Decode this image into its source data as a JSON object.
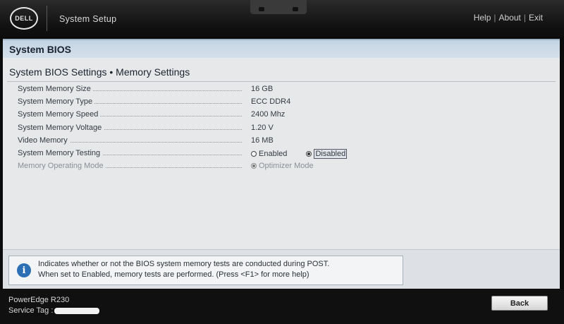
{
  "brand": {
    "logo_text": "DELL"
  },
  "app_title": "System Setup",
  "top_links": {
    "help": "Help",
    "about": "About",
    "exit": "Exit",
    "separator": "|"
  },
  "section_header": "System BIOS",
  "page_title": "System BIOS Settings • Memory Settings",
  "settings": [
    {
      "label": "System Memory Size",
      "value": "16 GB"
    },
    {
      "label": "System Memory Type",
      "value": "ECC DDR4"
    },
    {
      "label": "System Memory Speed",
      "value": "2400 Mhz"
    },
    {
      "label": "System Memory Voltage",
      "value": "1.20 V"
    },
    {
      "label": "Video Memory",
      "value": "16 MB"
    },
    {
      "label": "System Memory Testing",
      "options": [
        {
          "label": "Enabled",
          "selected": false
        },
        {
          "label": "Disabled",
          "selected": true
        }
      ]
    },
    {
      "label": "Memory Operating Mode",
      "disabled": true,
      "options": [
        {
          "label": "Optimizer Mode",
          "selected": true
        }
      ]
    }
  ],
  "help": {
    "line1": "Indicates whether or not the BIOS system memory tests are conducted during POST.",
    "line2": "When set to Enabled, memory tests are performed. (Press <F1> for more help)",
    "icon": "info-icon"
  },
  "footer": {
    "model": "PowerEdge R230",
    "service_tag_label": "Service Tag :",
    "back_button": "Back"
  },
  "colors": {
    "header_band": "#c4d4e3",
    "panel": "#e6e8ea",
    "info_icon": "#2d6fb5"
  }
}
